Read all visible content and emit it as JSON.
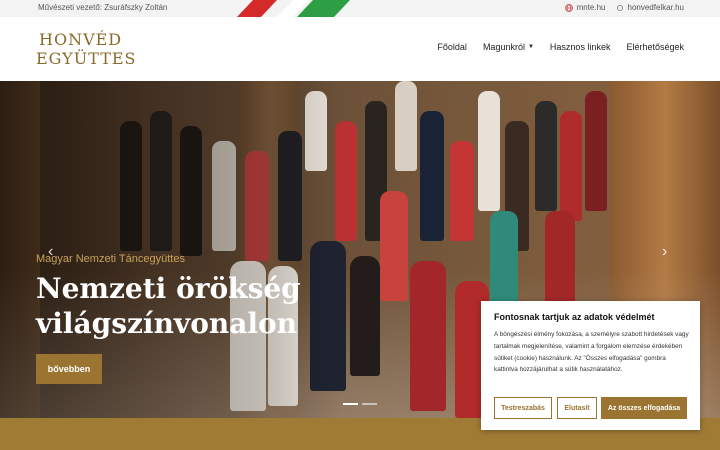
{
  "topbar": {
    "director": "Művészeti vezető: Zsuráfszky Zoltán",
    "links": [
      {
        "label": "mnte.hu",
        "icon": "globe-icon"
      },
      {
        "label": "honvedfelkar.hu",
        "icon": "link-icon"
      }
    ]
  },
  "logo": {
    "line1": "HONVÉD",
    "line2": "EGYÜTTES"
  },
  "nav": {
    "items": [
      {
        "label": "Főoldal"
      },
      {
        "label": "Magunkról"
      },
      {
        "label": "Hasznos linkek"
      },
      {
        "label": "Elérhetőségek"
      }
    ]
  },
  "hero": {
    "subtitle": "Magyar Nemzeti Táncegyüttes",
    "title": "Nemzeti örökség világszínvonalon",
    "button": "bővebben",
    "prev_icon": "chevron-left-icon",
    "next_icon": "chevron-right-icon"
  },
  "cookie": {
    "title": "Fontosnak tartjuk az adatok védelmét",
    "text": "A böngészési élmény fokozása, a személyre szabott hirdetések vagy tartalmak megjelenítése, valamint a forgalom elemzése érdekében sütiket (cookie) használunk. Az \"Összes elfogadása\" gombra kattintva hozzájárulhat a sütik használatához.",
    "btn_customize": "Testreszabás",
    "btn_reject": "Elutasít",
    "btn_accept": "Az összes elfogadása"
  },
  "colors": {
    "accent": "#9a7430",
    "flag_red": "#d42a2a",
    "flag_green": "#2e9e44"
  }
}
